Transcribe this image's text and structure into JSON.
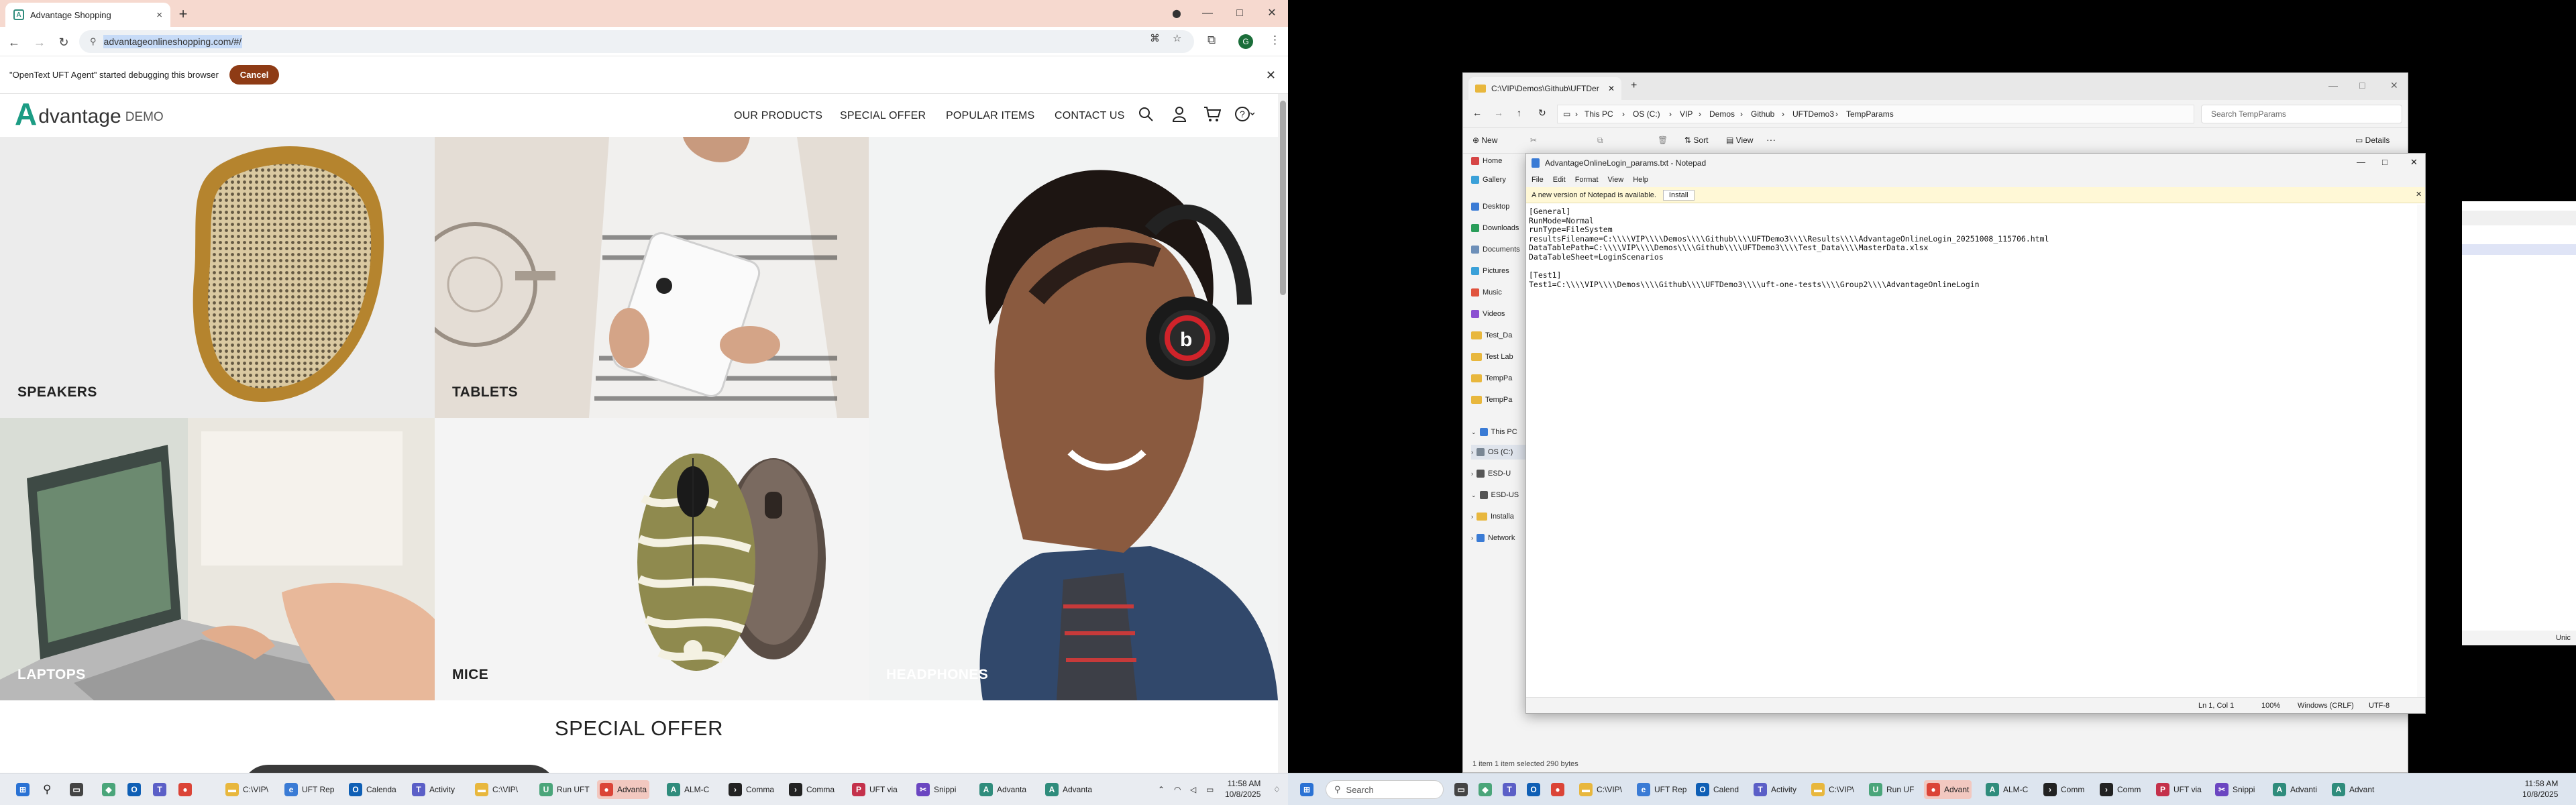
{
  "left_monitor": {
    "browser": {
      "tab_title": "Advantage Shopping",
      "url": "advantageonlineshopping.com/#/",
      "debug_message": "\"OpenText UFT Agent\" started debugging this browser",
      "debug_cancel": "Cancel",
      "new_tab": "+",
      "tab_close": "×",
      "win_min": "—",
      "win_max": "□",
      "win_close": "✕",
      "nav_back": "←",
      "nav_forward": "→",
      "nav_reload": "↻",
      "profile_initial": "G",
      "menu": "⋮"
    },
    "site": {
      "logo_a": "A",
      "logo_text": "dvantage",
      "logo_demo": "DEMO",
      "nav": [
        "OUR PRODUCTS",
        "SPECIAL OFFER",
        "POPULAR ITEMS",
        "CONTACT US"
      ],
      "categories": {
        "speakers": "SPEAKERS",
        "tablets": "TABLETS",
        "headphones": "HEADPHONES",
        "laptops": "LAPTOPS",
        "mice": "MICE"
      },
      "special_offer_title": "SPECIAL OFFER"
    },
    "taskbar": {
      "items": [
        "C:\\VIP\\",
        "UFT Rep",
        "Calenda",
        "Activity",
        "C:\\VIP\\",
        "Run UFT",
        "Advanta",
        "ALM-C",
        "Comma",
        "Comma",
        "UFT via",
        "Snippi",
        "Advanta",
        "Advanta"
      ],
      "time": "11:58 AM",
      "date": "10/8/2025"
    }
  },
  "right_monitor": {
    "explorer": {
      "tab_title": "C:\\VIP\\Demos\\Github\\UFTDer",
      "breadcrumb": [
        "This PC",
        "OS (C:)",
        "VIP",
        "Demos",
        "Github",
        "UFTDemo3",
        "TempParams"
      ],
      "search_placeholder": "Search TempParams",
      "cmd": {
        "new": "New",
        "sort": "Sort",
        "view": "View",
        "more": "···",
        "details": "Details"
      },
      "nav_items": [
        "Home",
        "Gallery",
        "Desktop",
        "Downloads",
        "Documents",
        "Pictures",
        "Music",
        "Videos",
        "Test_Da",
        "Test Lab",
        "TempPa",
        "TempPa",
        "This PC",
        "OS (C:)",
        "ESD-U",
        "ESD-US",
        "Installa",
        "Network"
      ],
      "status": "1 item    1 item selected  290 bytes"
    },
    "notepad": {
      "title": "AdvantageOnlineLogin_params.txt - Notepad",
      "menu": [
        "File",
        "Edit",
        "Format",
        "View",
        "Help"
      ],
      "banner": "A new version of Notepad is available.",
      "banner_button": "Install",
      "lines": [
        "[General]",
        "RunMode=Normal",
        "runType=FileSystem",
        "resultsFilename=C:\\\\\\\\VIP\\\\\\\\Demos\\\\\\\\Github\\\\\\\\UFTDemo3\\\\\\\\Results\\\\\\\\AdvantageOnlineLogin_20251008_115706.html",
        "DataTablePath=C:\\\\\\\\VIP\\\\\\\\Demos\\\\\\\\Github\\\\\\\\UFTDemo3\\\\\\\\Test_Data\\\\\\\\MasterData.xlsx",
        "DataTableSheet=LoginScenarios",
        "",
        "[Test1]",
        "Test1=C:\\\\\\\\VIP\\\\\\\\Demos\\\\\\\\Github\\\\\\\\UFTDemo3\\\\\\\\uft-one-tests\\\\\\\\Group2\\\\\\\\AdvantageOnlineLogin"
      ],
      "status": {
        "position": "Ln 1, Col 1",
        "zoom": "100%",
        "eol": "Windows (CRLF)",
        "encoding": "UTF-8"
      }
    },
    "taskbar": {
      "search": "Search",
      "items": [
        "C:\\VIP\\",
        "UFT Rep",
        "Calend",
        "Activity",
        "C:\\VIP\\",
        "Run UF",
        "Advant",
        "ALM-C",
        "Comm",
        "Comm",
        "UFT via",
        "Snippi",
        "Advanti",
        "Advant"
      ],
      "time": "11:58 AM",
      "date": "10/8/2025",
      "edge_text": "Unic"
    }
  }
}
